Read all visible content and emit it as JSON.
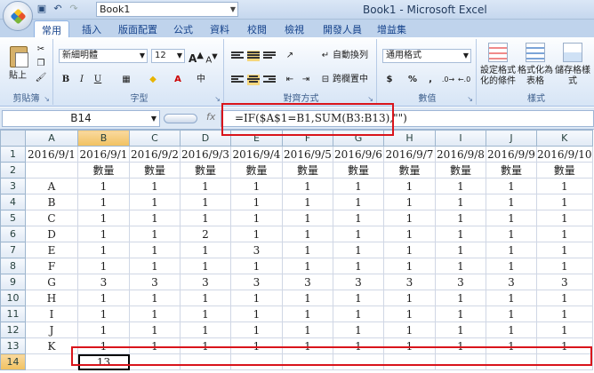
{
  "titlebar": {
    "book_combo": "Book1",
    "window_title": "Book1 - Microsoft Excel"
  },
  "tabs": [
    "常用",
    "插入",
    "版面配置",
    "公式",
    "資料",
    "校閱",
    "檢視",
    "開發人員",
    "增益集"
  ],
  "ribbon": {
    "clipboard": {
      "label": "剪貼簿",
      "paste": "貼上"
    },
    "font": {
      "label": "字型",
      "name": "新細明體",
      "size": "12",
      "bold": "B",
      "italic": "I",
      "underline": "U",
      "grow": "A",
      "shrink": "A"
    },
    "alignment": {
      "label": "對齊方式",
      "wrap": "自動換列",
      "merge": "跨欄置中"
    },
    "number": {
      "label": "數值",
      "format": "通用格式",
      "currency": "$",
      "percent": "%",
      "comma": ","
    },
    "styles": {
      "label": "樣式",
      "conditional": "設定格式化的條件",
      "as_table": "格式化為表格",
      "cell_styles": "儲存格樣式"
    }
  },
  "formula_bar": {
    "name_box": "B14",
    "fx": "fx",
    "formula": "=IF($A$1=B1,SUM(B3:B13),\"\")"
  },
  "grid": {
    "columns": [
      "A",
      "B",
      "C",
      "D",
      "E",
      "F",
      "G",
      "H",
      "I",
      "J",
      "K"
    ],
    "rows": [
      [
        "1",
        "2016/9/1",
        "2016/9/1",
        "2016/9/2",
        "2016/9/3",
        "2016/9/4",
        "2016/9/5",
        "2016/9/6",
        "2016/9/7",
        "2016/9/8",
        "2016/9/9",
        "2016/9/10"
      ],
      [
        "2",
        "",
        "數量",
        "數量",
        "數量",
        "數量",
        "數量",
        "數量",
        "數量",
        "數量",
        "數量",
        "數量"
      ],
      [
        "3",
        "A",
        "1",
        "1",
        "1",
        "1",
        "1",
        "1",
        "1",
        "1",
        "1",
        "1"
      ],
      [
        "4",
        "B",
        "1",
        "1",
        "1",
        "1",
        "1",
        "1",
        "1",
        "1",
        "1",
        "1"
      ],
      [
        "5",
        "C",
        "1",
        "1",
        "1",
        "1",
        "1",
        "1",
        "1",
        "1",
        "1",
        "1"
      ],
      [
        "6",
        "D",
        "1",
        "1",
        "2",
        "1",
        "1",
        "1",
        "1",
        "1",
        "1",
        "1"
      ],
      [
        "7",
        "E",
        "1",
        "1",
        "1",
        "3",
        "1",
        "1",
        "1",
        "1",
        "1",
        "1"
      ],
      [
        "8",
        "F",
        "1",
        "1",
        "1",
        "1",
        "1",
        "1",
        "1",
        "1",
        "1",
        "1"
      ],
      [
        "9",
        "G",
        "3",
        "3",
        "3",
        "3",
        "3",
        "3",
        "3",
        "3",
        "3",
        "3"
      ],
      [
        "10",
        "H",
        "1",
        "1",
        "1",
        "1",
        "1",
        "1",
        "1",
        "1",
        "1",
        "1"
      ],
      [
        "11",
        "I",
        "1",
        "1",
        "1",
        "1",
        "1",
        "1",
        "1",
        "1",
        "1",
        "1"
      ],
      [
        "12",
        "J",
        "1",
        "1",
        "1",
        "1",
        "1",
        "1",
        "1",
        "1",
        "1",
        "1"
      ],
      [
        "13",
        "K",
        "1",
        "1",
        "1",
        "1",
        "1",
        "1",
        "1",
        "1",
        "1",
        "1"
      ],
      [
        "14",
        "",
        "13",
        "",
        "",
        "",
        "",
        "",
        "",
        "",
        "",
        ""
      ]
    ],
    "active_cell": "B14"
  }
}
